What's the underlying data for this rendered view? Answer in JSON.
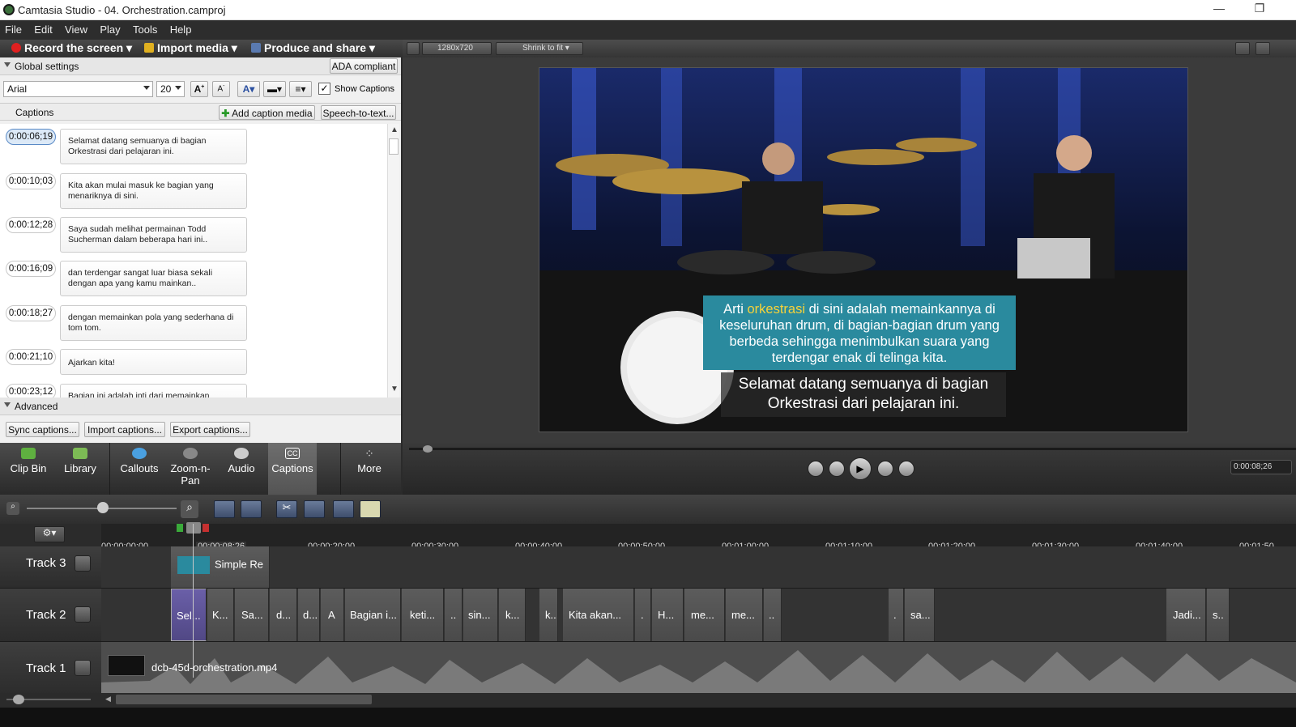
{
  "window": {
    "title": "Camtasia Studio - 04. Orchestration.camproj",
    "minimize": "—",
    "restore": "❐"
  },
  "menu": [
    "File",
    "Edit",
    "View",
    "Play",
    "Tools",
    "Help"
  ],
  "toolbar": {
    "record": "Record the screen",
    "import": "Import media",
    "produce": "Produce and share"
  },
  "global_settings": {
    "label": "Global settings",
    "ada_button": "ADA compliant"
  },
  "font": {
    "family": "Arial",
    "size": "20",
    "show_captions": "Show Captions"
  },
  "captions": {
    "label": "Captions",
    "add_media": "Add caption media",
    "speech_to_text": "Speech-to-text...",
    "items": [
      {
        "time": "0:00:06;19",
        "text": "Selamat datang semuanya di bagian Orkestrasi dari pelajaran ini."
      },
      {
        "time": "0:00:10;03",
        "text": "Kita akan mulai masuk ke bagian yang menariknya di sini."
      },
      {
        "time": "0:00:12;28",
        "text": "Saya sudah melihat permainan Todd Sucherman dalam beberapa hari ini.."
      },
      {
        "time": "0:00:16;09",
        "text": "dan terdengar sangat luar biasa sekali dengan apa yang kamu mainkan.."
      },
      {
        "time": "0:00:18;27",
        "text": "dengan memainkan pola yang sederhana di tom tom."
      },
      {
        "time": "0:00:21;10",
        "text": "Ajarkan kita!"
      },
      {
        "time": "0:00:23;12",
        "text": "Bagian ini adalah inti dari memainkan"
      }
    ]
  },
  "advanced": {
    "label": "Advanced",
    "sync": "Sync captions...",
    "import": "Import captions...",
    "export": "Export captions..."
  },
  "tasks": [
    {
      "label": "Clip Bin",
      "icon": "clip-bin-icon",
      "color": "#5fb040"
    },
    {
      "label": "Library",
      "icon": "library-icon",
      "color": "#7dbb55"
    },
    {
      "label": "Callouts",
      "icon": "callouts-icon",
      "color": "#4aa0e0"
    },
    {
      "label": "Zoom-n-\nPan",
      "icon": "zoom-n-pan-icon",
      "color": "#888888"
    },
    {
      "label": "Audio",
      "icon": "audio-icon",
      "color": "#cccccc"
    },
    {
      "label": "Captions",
      "icon": "captions-icon",
      "color": "#ffffff"
    },
    {
      "label": "More",
      "icon": "more-icon",
      "color": "#dddddd"
    }
  ],
  "preview": {
    "dimensions": "1280x720",
    "zoom": "Shrink to fit",
    "callout_pre": "Arti ",
    "callout_highlight": "orkestrasi",
    "callout_post": " di sini adalah memainkannya di keseluruhan drum, di bagian-bagian drum yang berbeda sehingga menimbulkan suara yang terdengar enak di telinga kita.",
    "subtitle": "Selamat datang semuanya di bagian Orkestrasi dari pelajaran ini.",
    "time_display": "0:00:08;26",
    "highlight_color": "#f6d23a",
    "callout_color": "#2a8a9e"
  },
  "ruler": {
    "ticks": [
      "00:00:00;00",
      "00:00:08;26",
      "00:00:20;00",
      "00:00:30;00",
      "00:00:40;00",
      "00:00:50;00",
      "00:01:00;00",
      "00:01:10;00",
      "00:01:20;00",
      "00:01:30;00",
      "00:01:40;00",
      "00:01:50"
    ]
  },
  "tracks": {
    "track3": {
      "name": "Track 3",
      "clip": "Simple Re"
    },
    "track2": {
      "name": "Track 2",
      "clips": [
        "Sel...",
        "K...",
        "Sa...",
        "d...",
        "d...",
        "A",
        "Bagian i...",
        "keti...",
        "..",
        "sin...",
        "k...",
        "k...",
        "Kita akan...",
        ".",
        "H...",
        "me...",
        "me...",
        "..",
        ".",
        "sa...",
        "Jadi...",
        "s.."
      ]
    },
    "track1": {
      "name": "Track 1",
      "clip": "dcb-45d-orchestration.mp4"
    }
  }
}
